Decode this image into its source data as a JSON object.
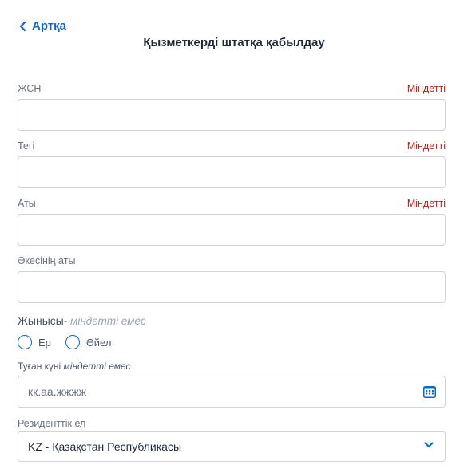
{
  "header": {
    "back_label": "Артқа",
    "title": "Қызметкерді штатқа қабылдау"
  },
  "form": {
    "required_label": "Міндетті",
    "iin": {
      "label": "ЖСН",
      "value": ""
    },
    "surname": {
      "label": "Тегі",
      "value": ""
    },
    "name": {
      "label": "Аты",
      "value": ""
    },
    "patronymic": {
      "label": "Әкесінің аты",
      "value": ""
    },
    "gender": {
      "label": "Жынысы",
      "optional": "- міндетті емес",
      "options": [
        "Ер",
        "Әйел"
      ]
    },
    "birth_date": {
      "label": "Туған күні ",
      "optional": "міндетті емес",
      "placeholder": "кк.аа.жжжж"
    },
    "residency": {
      "label": "Резиденттік ел",
      "selected": "KZ - Қазақстан Республикасы"
    }
  },
  "colors": {
    "accent": "#1565c0",
    "required": "#b42318",
    "border": "#cfd4da"
  },
  "icons": {
    "back": "chevron-left-icon",
    "calendar": "calendar-icon",
    "dropdown": "chevron-down-icon"
  }
}
